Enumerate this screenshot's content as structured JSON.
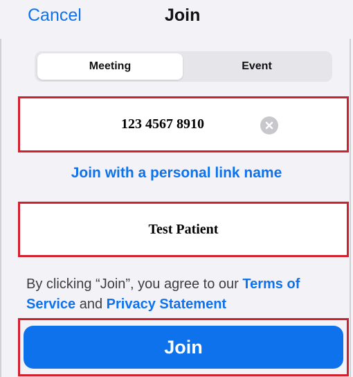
{
  "header": {
    "cancel_label": "Cancel",
    "title": "Join"
  },
  "segmented_control": {
    "options": [
      {
        "label": "Meeting",
        "selected": true
      },
      {
        "label": "Event",
        "selected": false
      }
    ]
  },
  "meeting_id_field": {
    "value": "123 4567 8910",
    "clear_icon": "clear-circle-x"
  },
  "personal_link_label": "Join with a personal link name",
  "name_field": {
    "value": "Test Patient"
  },
  "legal": {
    "prefix": "By clicking “Join”, you agree to our ",
    "terms_label": "Terms of Service",
    "conjunction": " and ",
    "privacy_label": "Privacy Statement"
  },
  "join_button_label": "Join",
  "colors": {
    "accent": "#0e72ed",
    "highlight_border": "#d3202e",
    "background": "#f2f2f7"
  }
}
